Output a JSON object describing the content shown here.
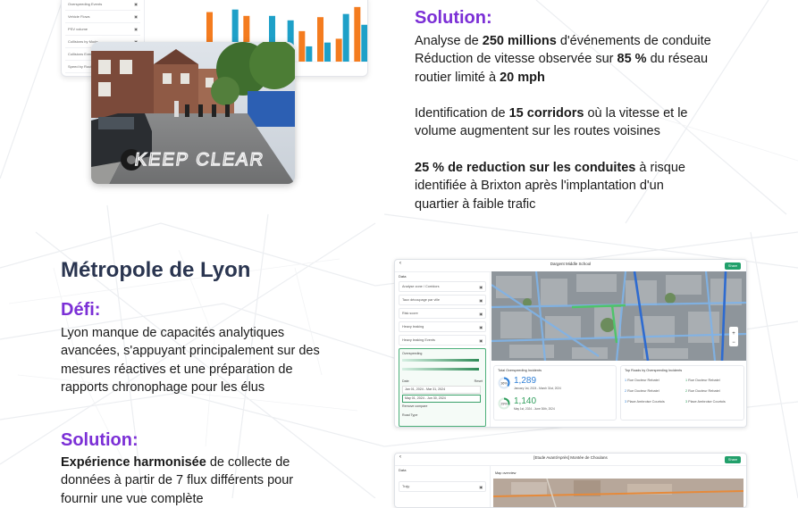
{
  "card1": {
    "sidebar_items": [
      "Overspeeding Events",
      "Vehicle Flows",
      "PSV volume",
      "Collisions by Mode",
      "Collisions Events",
      "Speed by Route"
    ],
    "chart": {
      "type": "bar",
      "series": [
        {
          "color": "#f47c1f",
          "values": [
            78,
            20,
            72,
            5,
            5,
            48,
            70,
            36,
            86
          ]
        },
        {
          "color": "#1ea0c8",
          "values": [
            22,
            82,
            18,
            72,
            65,
            24,
            30,
            75,
            58
          ]
        }
      ]
    },
    "mini_chart": {
      "type": "bar",
      "series": [
        {
          "color": "#f47c1f",
          "values": [
            8,
            12,
            18,
            22
          ]
        },
        {
          "color": "#1ea0c8",
          "values": [
            10,
            14,
            24,
            34
          ]
        }
      ]
    }
  },
  "photo": {
    "road_marking": "KEEP CLEAR"
  },
  "section1": {
    "solution_heading": "Solution:",
    "p1_pre": "Analyse de ",
    "p1_b1": "250 millions",
    "p1_mid1": " d'événements de conduite",
    "p1_line2_pre": "Réduction de vitesse observée sur ",
    "p1_b2": "85 %",
    "p1_line2_post": " du réseau",
    "p1_line3_pre": "routier limité à ",
    "p1_b3": "20 mph",
    "p2_pre": "Identification de ",
    "p2_b": "15 corridors",
    "p2_post1": " où la vitesse et le",
    "p2_line2": "volume augmentent sur les routes voisines",
    "p3_b": "25 % de reduction sur les conduites",
    "p3_post1": " à risque",
    "p3_line2": "identifiée à Brixton après l'implantation d'un",
    "p3_line3": "quartier à faible trafic"
  },
  "section2": {
    "city": "Métropole de Lyon",
    "defi_heading": "Défi:",
    "defi_l1": "Lyon manque de capacités analytiques",
    "defi_l2": "avancées, s'appuyant principalement sur des",
    "defi_l3": "mesures réactives et une préparation de",
    "defi_l4": "rapports chronophage pour les élus",
    "solution_heading": "Solution:",
    "sol_b": "Expérience harmonisée",
    "sol_post1": " de collecte de",
    "sol_l2": "données à partir de 7 flux différents pour",
    "sol_l3": "fournir une vue complète"
  },
  "card2": {
    "title": "Dargent Middle School",
    "share": "Share",
    "data_label": "Data",
    "sidebar_items": [
      "Analyse zone / Corridors",
      "Taux découpage par ville",
      "Risk score",
      "Heavy braking",
      "Heavy braking Events"
    ],
    "panel_title": "Overspeeding",
    "date_heading": "Date",
    "date_reset": "Reset",
    "date_range1": "Jan 01, 2024 - Mar 31, 2024",
    "date_range2": "May 01, 2024 - Jun 30, 2024",
    "compare_label": "Remove compare",
    "road_type": "Road Type",
    "total_title": "Total Overspeeding Incidents",
    "total_value1": "1,289",
    "total_sub1": "January 1st, 2024 - March 31st, 2024",
    "total_value2": "1,140",
    "total_sub2": "May 1st, 2024 - June 30th, 2024",
    "ring1": "36%",
    "ring2": "29%",
    "top_title": "Top Roads by Overspeeding Incidents",
    "roads_left": [
      "Rue Docteur Rebatel",
      "Rue Docteur Rebatel",
      "Place Ambroise Courtois"
    ],
    "roads_right": [
      "Rue Docteur Rebatel",
      "Rue Docteur Rebatel",
      "Place Ambroise Courtois"
    ]
  },
  "card3": {
    "title": "[Etude Avant/Après] Montée de Choulans",
    "share": "Share",
    "data_label": "Data",
    "map_overview": "Map overview",
    "sidebar_items": [
      "Trajy"
    ]
  }
}
